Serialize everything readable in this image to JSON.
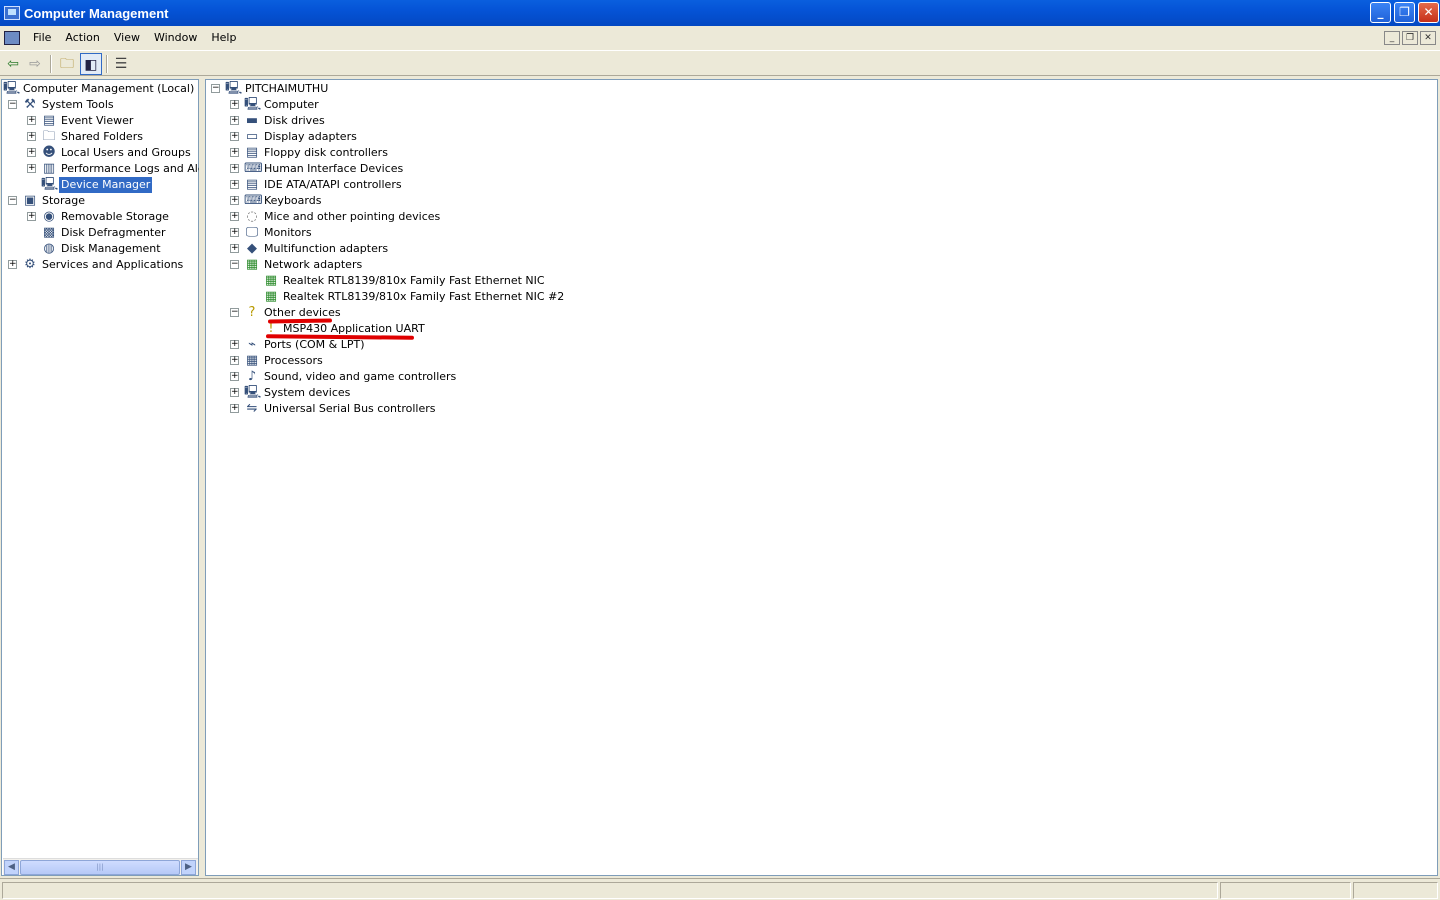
{
  "window": {
    "title": "Computer Management"
  },
  "menu": [
    "File",
    "Action",
    "View",
    "Window",
    "Help"
  ],
  "left_tree": [
    {
      "label": "Computer Management (Local)",
      "icon": "computer-management-icon",
      "expander": ""
    },
    {
      "label": "System Tools",
      "icon": "system-tools-icon",
      "expander": "−"
    },
    {
      "label": "Event Viewer",
      "icon": "event-viewer-icon",
      "expander": "+"
    },
    {
      "label": "Shared Folders",
      "icon": "shared-folders-icon",
      "expander": "+"
    },
    {
      "label": "Local Users and Groups",
      "icon": "users-groups-icon",
      "expander": "+"
    },
    {
      "label": "Performance Logs and Alerts",
      "icon": "performance-logs-icon",
      "expander": "+"
    },
    {
      "label": "Device Manager",
      "icon": "device-manager-icon",
      "expander": "",
      "selected": true
    },
    {
      "label": "Storage",
      "icon": "storage-icon",
      "expander": "−"
    },
    {
      "label": "Removable Storage",
      "icon": "removable-storage-icon",
      "expander": "+"
    },
    {
      "label": "Disk Defragmenter",
      "icon": "disk-defragmenter-icon",
      "expander": ""
    },
    {
      "label": "Disk Management",
      "icon": "disk-management-icon",
      "expander": ""
    },
    {
      "label": "Services and Applications",
      "icon": "services-applications-icon",
      "expander": "+"
    }
  ],
  "device_tree": {
    "root": "PITCHAIMUTHU",
    "categories": [
      {
        "label": "Computer",
        "icon": "computer-icon",
        "expander": "+"
      },
      {
        "label": "Disk drives",
        "icon": "disk-drive-icon",
        "expander": "+"
      },
      {
        "label": "Display adapters",
        "icon": "display-adapter-icon",
        "expander": "+"
      },
      {
        "label": "Floppy disk controllers",
        "icon": "floppy-controller-icon",
        "expander": "+"
      },
      {
        "label": "Human Interface Devices",
        "icon": "hid-icon",
        "expander": "+"
      },
      {
        "label": "IDE ATA/ATAPI controllers",
        "icon": "ide-controller-icon",
        "expander": "+"
      },
      {
        "label": "Keyboards",
        "icon": "keyboard-icon",
        "expander": "+"
      },
      {
        "label": "Mice and other pointing devices",
        "icon": "mouse-icon",
        "expander": "+"
      },
      {
        "label": "Monitors",
        "icon": "monitor-icon",
        "expander": "+"
      },
      {
        "label": "Multifunction adapters",
        "icon": "multifunction-adapter-icon",
        "expander": "+"
      },
      {
        "label": "Network adapters",
        "icon": "network-adapter-icon",
        "expander": "−"
      },
      {
        "label": "Realtek RTL8139/810x Family Fast Ethernet NIC",
        "icon": "network-card-icon",
        "expander": "",
        "child": true
      },
      {
        "label": "Realtek RTL8139/810x Family Fast Ethernet NIC #2",
        "icon": "network-card-icon",
        "expander": "",
        "child": true
      },
      {
        "label": "Other devices",
        "icon": "unknown-device-icon",
        "expander": "−"
      },
      {
        "label": "MSP430 Application UART",
        "icon": "warning-device-icon",
        "expander": "",
        "child": true
      },
      {
        "label": "Ports (COM & LPT)",
        "icon": "port-icon",
        "expander": "+"
      },
      {
        "label": "Processors",
        "icon": "processor-icon",
        "expander": "+"
      },
      {
        "label": "Sound, video and game controllers",
        "icon": "sound-icon",
        "expander": "+"
      },
      {
        "label": "System devices",
        "icon": "system-device-icon",
        "expander": "+"
      },
      {
        "label": "Universal Serial Bus controllers",
        "icon": "usb-icon",
        "expander": "+"
      }
    ]
  },
  "colors": {
    "selection": "#316ac5",
    "annotation": "#e00000",
    "titlebar": "#0553d6"
  }
}
